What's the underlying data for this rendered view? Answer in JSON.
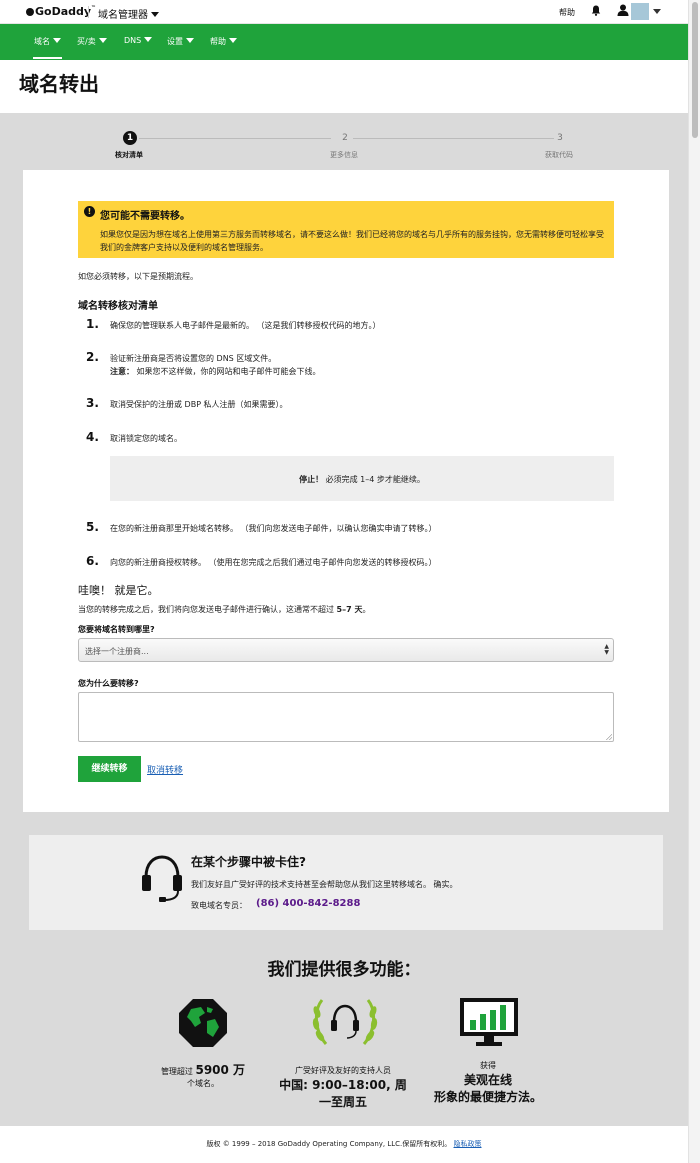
{
  "topbar": {
    "logo": "GoDaddy",
    "logo_tm": "™",
    "app_name": "域名管理器",
    "help": "帮助"
  },
  "nav": {
    "items": [
      {
        "label": "域名"
      },
      {
        "label": "买/卖"
      },
      {
        "label": "DNS"
      },
      {
        "label": "设置"
      },
      {
        "label": "帮助"
      }
    ]
  },
  "page": {
    "title": "域名转出"
  },
  "stepper": {
    "steps": [
      {
        "number": "1",
        "label": "核对清单",
        "active": true
      },
      {
        "number": "2",
        "label": "更多信息",
        "active": false
      },
      {
        "number": "3",
        "label": "获取代码",
        "active": false
      }
    ]
  },
  "alert": {
    "icon": "info-icon",
    "title": "您可能不需要转移。",
    "body": "如果您仅是因为想在域名上使用第三方服务而转移域名，请不要这么做！我们已经将您的域名与几乎所有的服务挂钩，您无需转移便可轻松享受我们的金牌客户支持以及便利的域名管理服务。"
  },
  "intro": "如您必须转移，以下是预期流程。",
  "checklist": {
    "title": "域名转移核对清单",
    "items": [
      {
        "number": "1.",
        "text": "确保您的管理联系人电子邮件是最新的。 （这是我们转移授权代码的地方。）"
      },
      {
        "number": "2.",
        "text": "验证新注册商是否将设置您的 DNS 区域文件。",
        "note_label": "注意：",
        "note_text": " 如果您不这样做，你的网站和电子邮件可能会下线。"
      },
      {
        "number": "3.",
        "text": "取消受保护的注册或 DBP 私人注册（如果需要）。"
      },
      {
        "number": "4.",
        "text": "取消锁定您的域名。"
      },
      {
        "number": "5.",
        "text": "在您的新注册商那里开始域名转移。 （我们向您发送电子邮件，以确认您确实申请了转移。）"
      },
      {
        "number": "6.",
        "text": "向您的新注册商授权转移。 （使用在您完成之后我们通过电子邮件向您发送的转移授权码。）"
      }
    ],
    "stop_label": "停止！",
    "stop_text": " 必须完成 1–4 步才能继续。"
  },
  "done": {
    "title": "哇噢！ 就是它。",
    "text_before": "当您的转移完成之后，我们将向您发送电子邮件进行确认，这通常不超过 ",
    "text_bold": "5–7 天",
    "text_after": "。"
  },
  "form": {
    "where_label": "您要将域名转到哪里?",
    "registrar_placeholder": "选择一个注册商...",
    "why_label": "您为什么要转移?",
    "why_value": "",
    "continue_label": "继续转移",
    "cancel_label": "取消转移"
  },
  "support": {
    "title": "在某个步骤中被卡住?",
    "body": "我们友好且广受好评的技术支持甚至会帮助您从我们这里转移域名。 确实。",
    "phone_label": "致电域名专员：",
    "phone": "(86) 400-842-8288"
  },
  "features": {
    "title": "我们提供很多功能：",
    "items": [
      {
        "icon": "globe-icon",
        "line1_small": "管理超过 ",
        "line1_big": "5900 万",
        "line2": "个域名。"
      },
      {
        "icon": "support-laurel-icon",
        "line1": "广受好评及友好的支持人员",
        "line2": "中国: 9:00–18:00, 周",
        "line3": "一至周五"
      },
      {
        "icon": "monitor-chart-icon",
        "line1": "获得",
        "line2": "美观在线",
        "line3": "形象的最便捷方法。"
      }
    ]
  },
  "footer": {
    "copyright": "版权 © 1999 – 2018 GoDaddy Operating Company, LLC.保留所有权利。",
    "privacy": "隐私政策"
  },
  "colors": {
    "brand_green": "#1fa33b",
    "alert_yellow": "#fed33c",
    "phone_purple": "#5b1a8a",
    "link_blue": "#1a5fb4"
  }
}
